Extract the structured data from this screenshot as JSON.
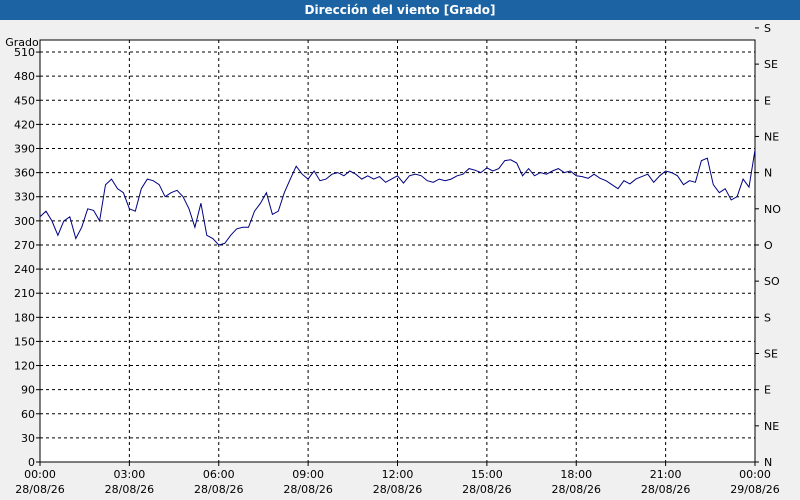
{
  "window": {
    "title": "Dirección del viento [Grado]"
  },
  "chart_data": {
    "type": "line",
    "title": "Dirección del viento [Grado]",
    "ylabel": "Grado",
    "ylim": [
      0,
      525
    ],
    "yticks": [
      0,
      30,
      60,
      90,
      120,
      150,
      180,
      210,
      240,
      270,
      300,
      330,
      360,
      390,
      420,
      450,
      480,
      510
    ],
    "right_axis_labels": [
      {
        "value": 0,
        "label": "N"
      },
      {
        "value": 45,
        "label": "NE"
      },
      {
        "value": 90,
        "label": "E"
      },
      {
        "value": 135,
        "label": "SE"
      },
      {
        "value": 180,
        "label": "S"
      },
      {
        "value": 225,
        "label": "SO"
      },
      {
        "value": 270,
        "label": "O"
      },
      {
        "value": 315,
        "label": "NO"
      },
      {
        "value": 360,
        "label": "N"
      },
      {
        "value": 405,
        "label": "NE"
      },
      {
        "value": 450,
        "label": "E"
      },
      {
        "value": 495,
        "label": "SE"
      },
      {
        "value": 540,
        "label": "S"
      }
    ],
    "xlim_hours": [
      0,
      24
    ],
    "xticks": [
      {
        "hour": 0,
        "time": "00:00",
        "date": "28/08/26"
      },
      {
        "hour": 3,
        "time": "03:00",
        "date": "28/08/26"
      },
      {
        "hour": 6,
        "time": "06:00",
        "date": "28/08/26"
      },
      {
        "hour": 9,
        "time": "09:00",
        "date": "28/08/26"
      },
      {
        "hour": 12,
        "time": "12:00",
        "date": "28/08/26"
      },
      {
        "hour": 15,
        "time": "15:00",
        "date": "28/08/26"
      },
      {
        "hour": 18,
        "time": "18:00",
        "date": "28/08/26"
      },
      {
        "hour": 21,
        "time": "21:00",
        "date": "28/08/26"
      },
      {
        "hour": 24,
        "time": "00:00",
        "date": "29/08/26"
      }
    ],
    "grid": true,
    "line_color": "#000080",
    "series": [
      {
        "x": [
          0,
          0.2,
          0.4,
          0.6,
          0.8,
          1.0,
          1.2,
          1.4,
          1.6,
          1.8,
          2.0,
          2.2,
          2.4,
          2.6,
          2.8,
          3.0,
          3.2,
          3.4,
          3.6,
          3.8,
          4.0,
          4.2,
          4.4,
          4.6,
          4.8,
          5.0,
          5.2,
          5.4,
          5.6,
          5.8,
          6.0,
          6.2,
          6.4,
          6.6,
          6.8,
          7.0,
          7.2,
          7.4,
          7.6,
          7.8,
          8.0,
          8.2,
          8.4,
          8.6,
          8.8,
          9.0,
          9.2,
          9.4,
          9.6,
          9.8,
          10.0,
          10.2,
          10.4,
          10.6,
          10.8,
          11.0,
          11.2,
          11.4,
          11.6,
          11.8,
          12.0,
          12.2,
          12.4,
          12.6,
          12.8,
          13.0,
          13.2,
          13.4,
          13.6,
          13.8,
          14.0,
          14.2,
          14.4,
          14.6,
          14.8,
          15.0,
          15.2,
          15.4,
          15.6,
          15.8,
          16.0,
          16.2,
          16.4,
          16.6,
          16.8,
          17.0,
          17.2,
          17.4,
          17.6,
          17.8,
          18.0,
          18.2,
          18.4,
          18.6,
          18.8,
          19.0,
          19.2,
          19.4,
          19.6,
          19.8,
          20.0,
          20.2,
          20.4,
          20.6,
          20.8,
          21.0,
          21.2,
          21.4,
          21.6,
          21.8,
          22.0,
          22.2,
          22.4,
          22.6,
          22.8,
          23.0,
          23.2,
          23.4,
          23.6,
          23.8,
          24.0
        ],
        "values": [
          305,
          312,
          300,
          282,
          300,
          305,
          278,
          292,
          315,
          313,
          300,
          345,
          352,
          340,
          335,
          315,
          312,
          340,
          352,
          350,
          345,
          330,
          335,
          338,
          330,
          315,
          292,
          322,
          282,
          278,
          270,
          272,
          282,
          290,
          292,
          292,
          312,
          322,
          335,
          308,
          312,
          335,
          352,
          368,
          358,
          352,
          362,
          350,
          352,
          358,
          360,
          356,
          362,
          358,
          352,
          356,
          352,
          355,
          348,
          352,
          356,
          347,
          356,
          358,
          356,
          350,
          348,
          352,
          350,
          352,
          356,
          358,
          365,
          363,
          360,
          366,
          362,
          365,
          375,
          376,
          372,
          356,
          365,
          356,
          360,
          358,
          362,
          365,
          360,
          362,
          356,
          355,
          353,
          358,
          353,
          350,
          345,
          340,
          350,
          346,
          352,
          355,
          358,
          348,
          356,
          362,
          360,
          356,
          345,
          350,
          348,
          375,
          378,
          345,
          335,
          340,
          326,
          330,
          352,
          342,
          388
        ]
      }
    ]
  }
}
